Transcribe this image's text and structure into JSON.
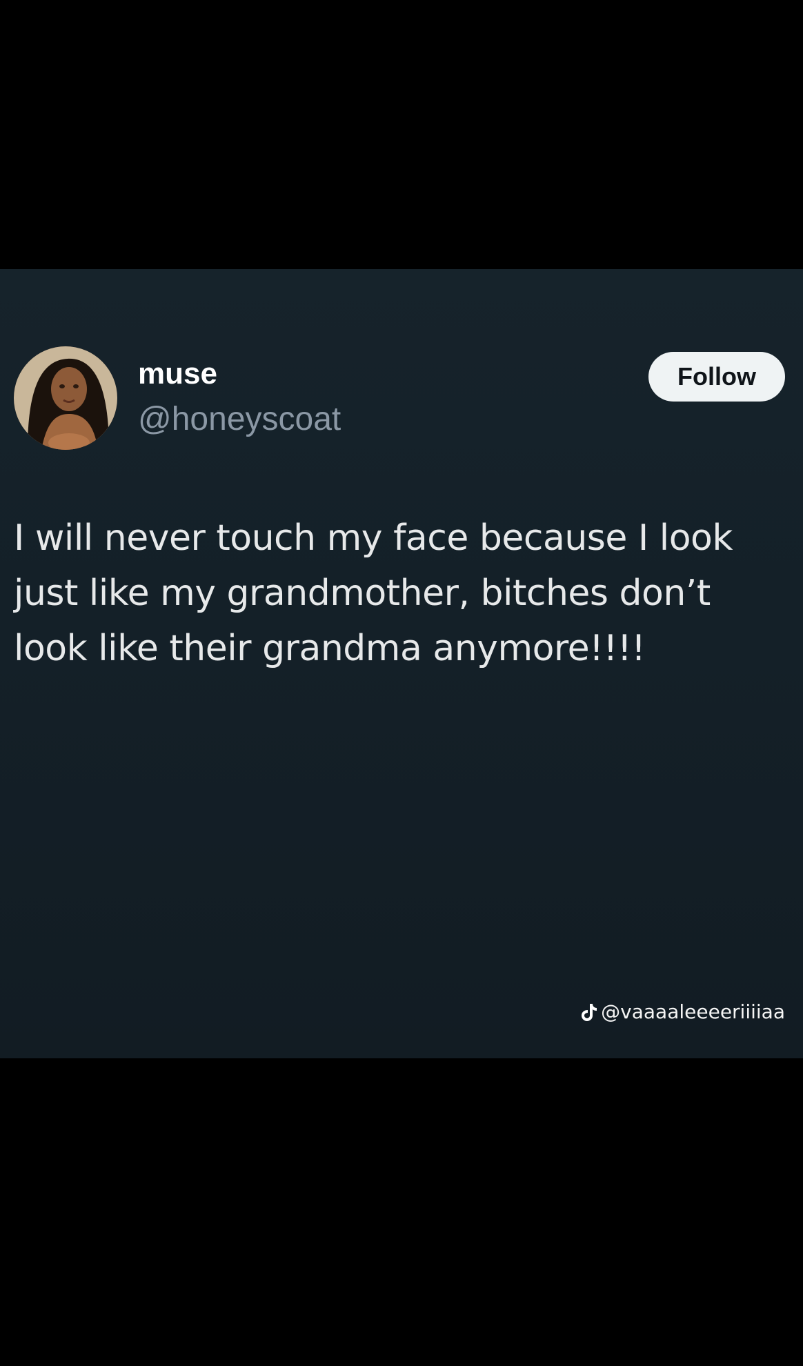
{
  "tweet": {
    "display_name": "muse",
    "handle": "@honeyscoat",
    "follow_label": "Follow",
    "text": "I will never touch my face because I look just like my grandmother, bitches don’t look like their grandma anymore!!!!"
  },
  "watermark": {
    "icon": "tiktok-icon",
    "username": "@vaaaaleeeeriiiiaa"
  },
  "colors": {
    "card_background": "#15222a",
    "letterbox": "#000000",
    "follow_button_bg": "#eff3f4",
    "handle_color": "#8b98a5"
  }
}
